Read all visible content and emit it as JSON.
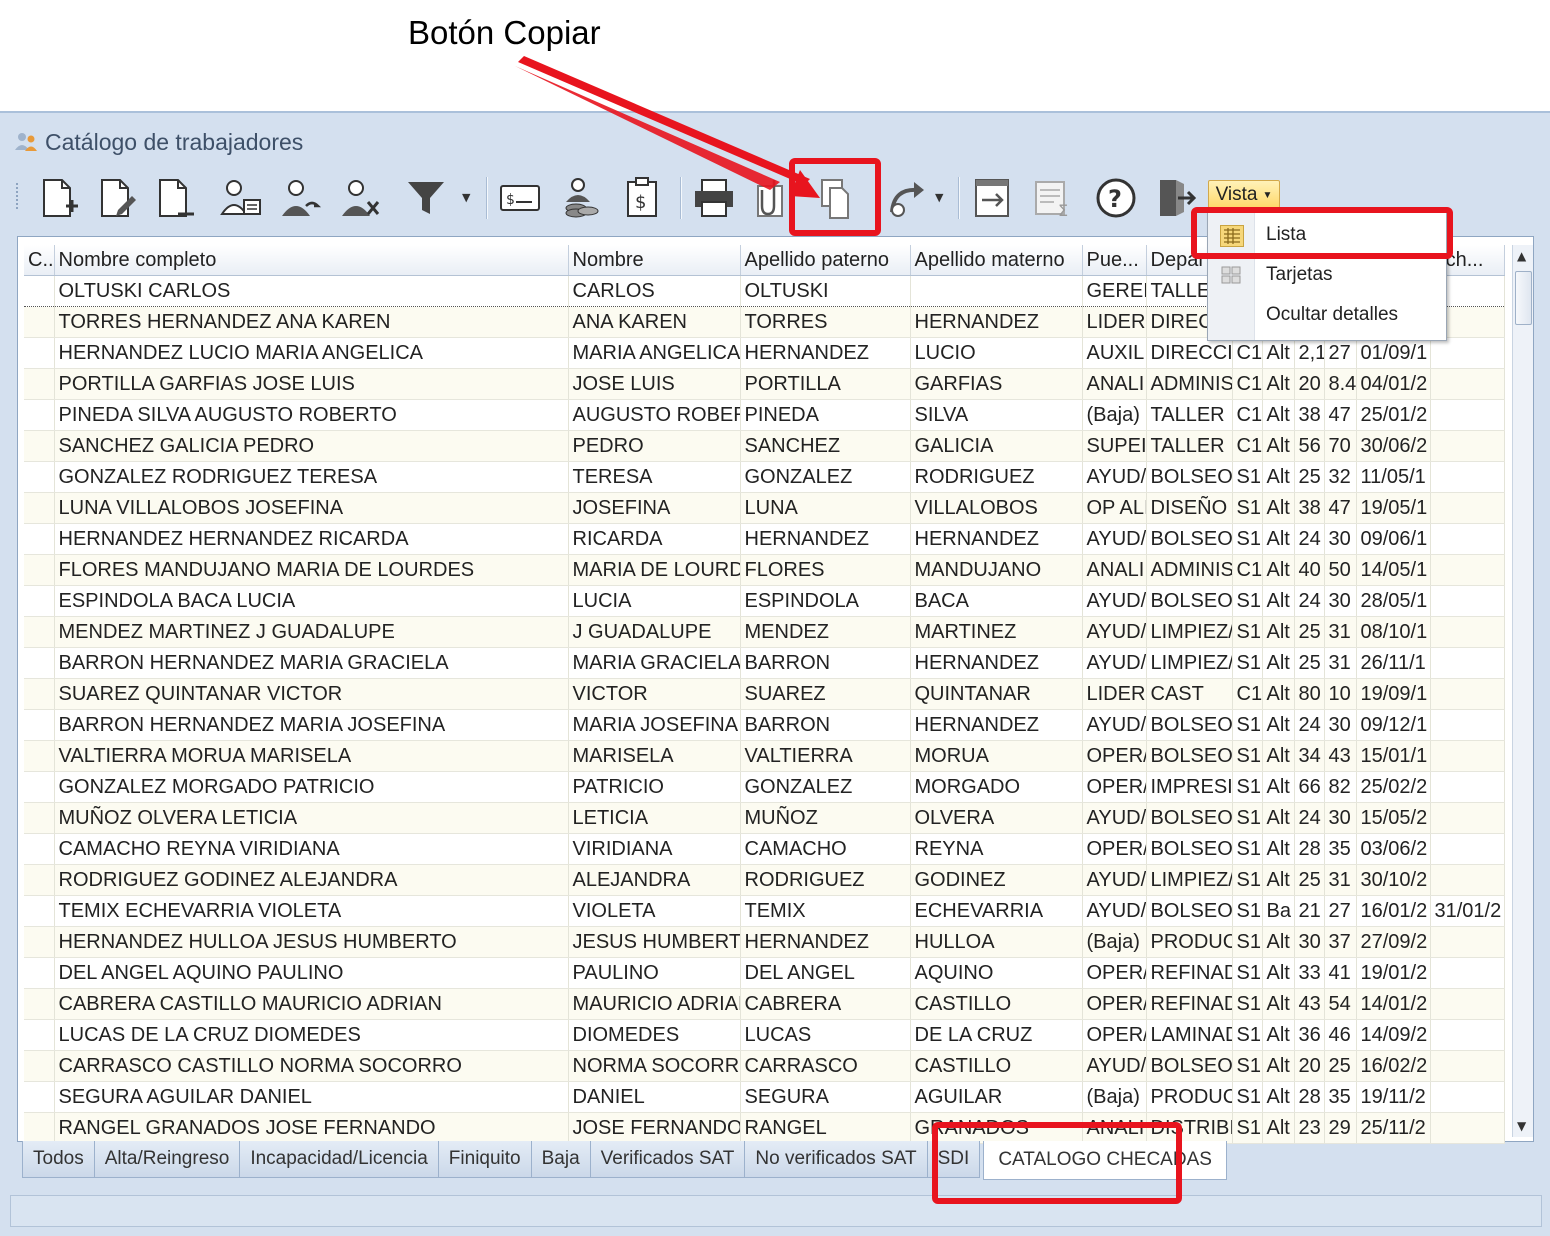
{
  "annotation": {
    "title": "Botón Copiar"
  },
  "window": {
    "title": "Catálogo de trabajadores"
  },
  "toolbar": {
    "buttons": [
      {
        "icon": "new-document-icon"
      },
      {
        "icon": "edit-document-icon"
      },
      {
        "icon": "delete-document-icon"
      },
      {
        "icon": "worker-card-icon"
      },
      {
        "icon": "worker-reinstate-icon"
      },
      {
        "icon": "worker-remove-icon"
      },
      {
        "icon": "filter-icon"
      },
      {
        "icon": "payroll-ticket-icon"
      },
      {
        "icon": "coins-worker-icon"
      },
      {
        "icon": "payment-receipt-icon"
      },
      {
        "icon": "print-icon"
      },
      {
        "icon": "attach-clip-icon"
      },
      {
        "icon": "copy-icon"
      },
      {
        "icon": "refresh-icon"
      },
      {
        "icon": "export-window-icon"
      },
      {
        "icon": "summary-sigma-icon"
      },
      {
        "icon": "help-icon"
      },
      {
        "icon": "exit-door-icon"
      }
    ],
    "vista_label": "Vista"
  },
  "vista_menu": {
    "items": [
      "Lista",
      "Tarjetas",
      "Ocultar detalles"
    ]
  },
  "grid": {
    "columns": [
      "C..",
      "Nombre completo",
      "Nombre",
      "Apellido paterno",
      "Apellido materno",
      "Pue...",
      "Depar",
      "",
      "",
      "",
      "",
      "",
      "ech..."
    ],
    "rows": [
      [
        "",
        "OLTUSKI  CARLOS",
        "CARLOS",
        "OLTUSKI",
        "",
        "GEREI",
        "TALLE",
        "",
        "",
        "",
        "",
        "",
        ""
      ],
      [
        "",
        "TORRES HERNANDEZ ANA KAREN",
        "ANA KAREN",
        "TORRES",
        "HERNANDEZ",
        "LIDER",
        "DIREC",
        "",
        "",
        "",
        "",
        "",
        ""
      ],
      [
        "",
        "HERNANDEZ LUCIO MARIA ANGELICA",
        "MARIA ANGELICA",
        "HERNANDEZ",
        "LUCIO",
        "AUXILI",
        "DIRECCI",
        "C1",
        "Alt",
        "2,1",
        "27",
        "01/09/1",
        ""
      ],
      [
        "",
        "PORTILLA GARFIAS JOSE LUIS",
        "JOSE LUIS",
        "PORTILLA",
        "GARFIAS",
        "ANALI!",
        "ADMINIS",
        "C1",
        "Alt",
        "20",
        "8.4",
        "04/01/2",
        ""
      ],
      [
        "",
        "PINEDA SILVA AUGUSTO ROBERTO",
        "AUGUSTO ROBERT",
        "PINEDA",
        "SILVA",
        "(Baja)",
        "TALLER",
        "C1",
        "Alt",
        "38",
        "47",
        "25/01/2",
        ""
      ],
      [
        "",
        "SANCHEZ GALICIA PEDRO",
        "PEDRO",
        "SANCHEZ",
        "GALICIA",
        "SUPEI",
        "TALLER",
        "C1",
        "Alt",
        "56",
        "70",
        "30/06/2",
        ""
      ],
      [
        "",
        "GONZALEZ RODRIGUEZ TERESA",
        "TERESA",
        "GONZALEZ",
        "RODRIGUEZ",
        "AYUD/",
        "BOLSEO",
        "S1",
        "Alt",
        "25",
        "32",
        "11/05/1",
        ""
      ],
      [
        "",
        "LUNA VILLALOBOS JOSEFINA",
        "JOSEFINA",
        "LUNA",
        "VILLALOBOS",
        "OP ALI",
        "DISEÑO",
        "S1",
        "Alt",
        "38",
        "47",
        "19/05/1",
        ""
      ],
      [
        "",
        "HERNANDEZ HERNANDEZ RICARDA",
        "RICARDA",
        "HERNANDEZ",
        "HERNANDEZ",
        "AYUD/",
        "BOLSEO",
        "S1",
        "Alt",
        "24",
        "30",
        "09/06/1",
        ""
      ],
      [
        "",
        "FLORES MANDUJANO MARIA DE LOURDES",
        "MARIA DE LOURDE",
        "FLORES",
        "MANDUJANO",
        "ANALI!",
        "ADMINIS",
        "C1",
        "Alt",
        "40",
        "50",
        "14/05/1",
        ""
      ],
      [
        "",
        "ESPINDOLA BACA LUCIA",
        "LUCIA",
        "ESPINDOLA",
        "BACA",
        "AYUD/",
        "BOLSEO",
        "S1",
        "Alt",
        "24",
        "30",
        "28/05/1",
        ""
      ],
      [
        "",
        "MENDEZ MARTINEZ J GUADALUPE",
        "J GUADALUPE",
        "MENDEZ",
        "MARTINEZ",
        "AYUD/",
        "LIMPIEZ/",
        "S1",
        "Alt",
        "25",
        "31",
        "08/10/1",
        ""
      ],
      [
        "",
        "BARRON HERNANDEZ MARIA GRACIELA",
        "MARIA GRACIELA",
        "BARRON",
        "HERNANDEZ",
        "AYUD/",
        "LIMPIEZ/",
        "S1",
        "Alt",
        "25",
        "31",
        "26/11/1",
        ""
      ],
      [
        "",
        "SUAREZ QUINTANAR VICTOR",
        "VICTOR",
        "SUAREZ",
        "QUINTANAR",
        "LIDER",
        "CAST",
        "C1",
        "Alt",
        "80",
        "10",
        "19/09/1",
        ""
      ],
      [
        "",
        "BARRON HERNANDEZ MARIA JOSEFINA",
        "MARIA JOSEFINA",
        "BARRON",
        "HERNANDEZ",
        "AYUD/",
        "BOLSEO",
        "S1",
        "Alt",
        "24",
        "30",
        "09/12/1",
        ""
      ],
      [
        "",
        "VALTIERRA MORUA MARISELA",
        "MARISELA",
        "VALTIERRA",
        "MORUA",
        "OPER/",
        "BOLSEO",
        "S1",
        "Alt",
        "34",
        "43",
        "15/01/1",
        ""
      ],
      [
        "",
        "GONZALEZ MORGADO PATRICIO",
        "PATRICIO",
        "GONZALEZ",
        "MORGADO",
        "OPER/",
        "IMPRESI",
        "S1",
        "Alt",
        "66",
        "82",
        "25/02/2",
        ""
      ],
      [
        "",
        "MUÑOZ OLVERA LETICIA",
        "LETICIA",
        "MUÑOZ",
        "OLVERA",
        "AYUD/",
        "BOLSEO",
        "S1",
        "Alt",
        "24",
        "30",
        "15/05/2",
        ""
      ],
      [
        "",
        "CAMACHO REYNA VIRIDIANA",
        "VIRIDIANA",
        "CAMACHO",
        "REYNA",
        "OPER/",
        "BOLSEO",
        "S1",
        "Alt",
        "28",
        "35",
        "03/06/2",
        ""
      ],
      [
        "",
        "RODRIGUEZ GODINEZ ALEJANDRA",
        "ALEJANDRA",
        "RODRIGUEZ",
        "GODINEZ",
        "AYUD/",
        "LIMPIEZ/",
        "S1",
        "Alt",
        "25",
        "31",
        "30/10/2",
        ""
      ],
      [
        "",
        "TEMIX ECHEVARRIA VIOLETA",
        "VIOLETA",
        "TEMIX",
        "ECHEVARRIA",
        "AYUD/",
        "BOLSEO",
        "S1",
        "Ba",
        "21",
        "27",
        "16/01/2",
        "31/01/2"
      ],
      [
        "",
        "HERNANDEZ HULLOA JESUS HUMBERTO",
        "JESUS HUMBERT(",
        "HERNANDEZ",
        "HULLOA",
        "(Baja)",
        "PRODUC",
        "S1",
        "Alt",
        "30",
        "37",
        "27/09/2",
        ""
      ],
      [
        "",
        "DEL ANGEL AQUINO PAULINO",
        "PAULINO",
        "DEL ANGEL",
        "AQUINO",
        "OPER/",
        "REFINAD",
        "S1",
        "Alt",
        "33",
        "41",
        "19/01/2",
        ""
      ],
      [
        "",
        "CABRERA CASTILLO MAURICIO ADRIAN",
        "MAURICIO ADRIAN",
        "CABRERA",
        "CASTILLO",
        "OPER/",
        "REFINAD",
        "S1",
        "Alt",
        "43",
        "54",
        "14/01/2",
        ""
      ],
      [
        "",
        "LUCAS DE LA CRUZ DIOMEDES",
        "DIOMEDES",
        "LUCAS",
        "DE LA CRUZ",
        "OPER/",
        "LAMINAD",
        "S1",
        "Alt",
        "36",
        "46",
        "14/09/2",
        ""
      ],
      [
        "",
        "CARRASCO CASTILLO NORMA SOCORRO",
        "NORMA SOCORRC",
        "CARRASCO",
        "CASTILLO",
        "AYUD/",
        "BOLSEO",
        "S1",
        "Alt",
        "20",
        "25",
        "16/02/2",
        ""
      ],
      [
        "",
        "SEGURA AGUILAR DANIEL",
        "DANIEL",
        "SEGURA",
        "AGUILAR",
        "(Baja)",
        "PRODUC",
        "S1",
        "Alt",
        "28",
        "35",
        "19/11/2",
        ""
      ],
      [
        "",
        "RANGEL GRANADOS JOSE FERNANDO",
        "JOSE FERNANDO",
        "RANGEL",
        "GRANADOS",
        "ANALI!",
        "DISTRIBI",
        "S1",
        "Alt",
        "23",
        "29",
        "25/11/2",
        ""
      ]
    ]
  },
  "tabs": [
    "Todos",
    "Alta/Reingreso",
    "Incapacidad/Licencia",
    "Finiquito",
    "Baja",
    "Verificados SAT",
    "No verificados SAT",
    "SDI",
    "CATALOGO CHECADAS"
  ],
  "colors": {
    "highlight_red": "#e8141e",
    "window_bg": "#d4e0ef",
    "vista_yellow": "#ffd767"
  }
}
